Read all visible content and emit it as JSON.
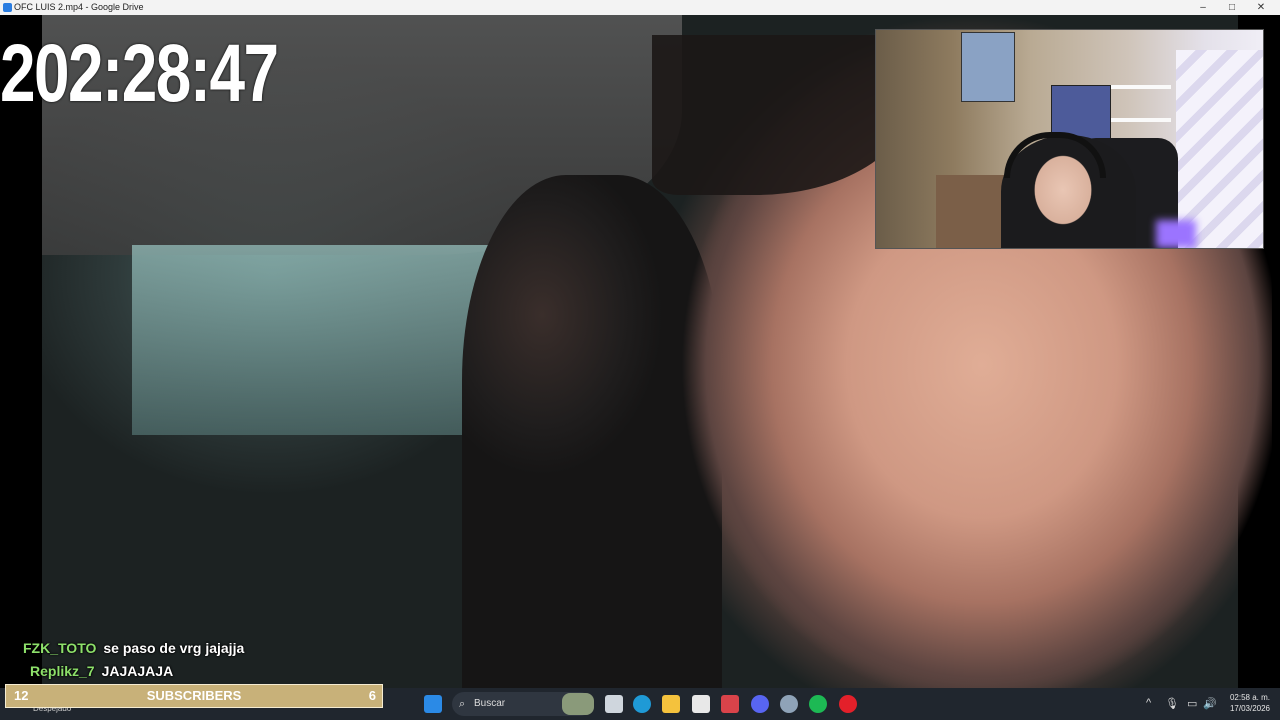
{
  "window": {
    "title": "OFC LUIS 2.mp4 - Google Drive",
    "minimize": "–",
    "maximize": "□",
    "close": "✕"
  },
  "overlay": {
    "timer": "202:28:47",
    "chat": [
      {
        "user": "FZK_TOTO",
        "message": "se paso de vrg jajajja"
      },
      {
        "user": "Replikz_7",
        "message": "JAJAJAJA"
      }
    ],
    "subscribers": {
      "left": "12",
      "label": "SUBSCRIBERS",
      "right": "6"
    }
  },
  "taskbar": {
    "weather": "Despejado",
    "search_placeholder": "Buscar",
    "search_icon": "⌕",
    "tray_chevron": "^",
    "tray_mic": "🎙",
    "tray_monitor": "▭",
    "tray_volume": "🔊",
    "time": "02:58 a. m.",
    "date": "17/03/2026",
    "colors": {
      "start": "#2b8ae6",
      "edge": "#1f9ad6",
      "files": "#f4c23d",
      "store": "#e8e8e8",
      "discord": "#5865f2",
      "spotify": "#1db954",
      "opera": "#e3202a",
      "chrome": "#8fa3b8"
    }
  }
}
